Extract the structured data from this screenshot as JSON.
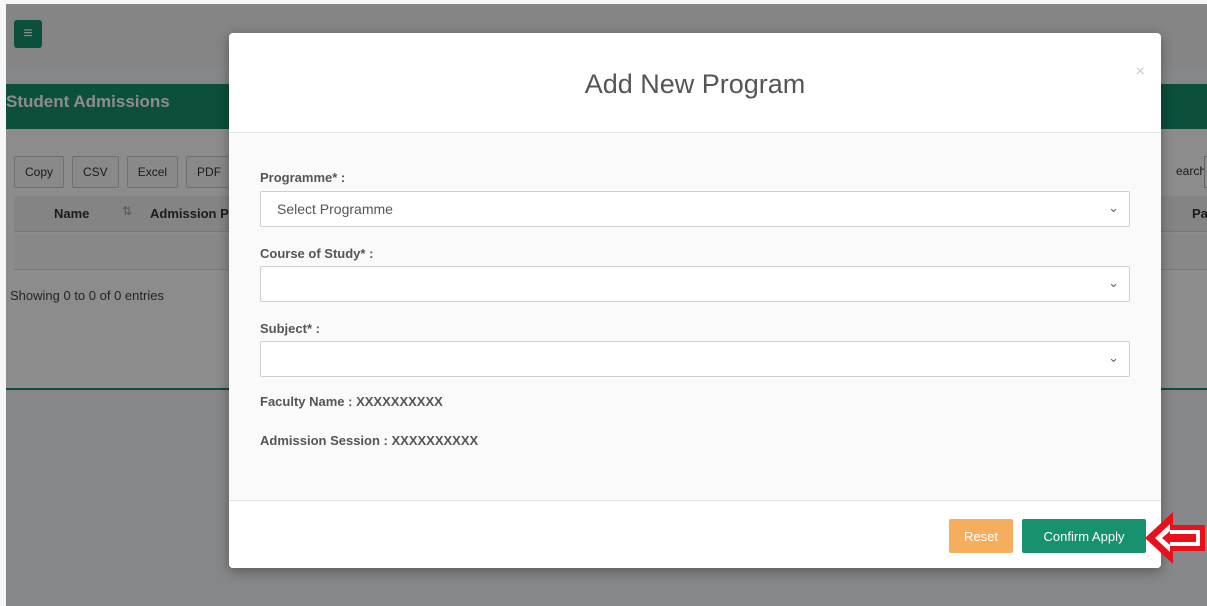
{
  "background": {
    "section_title": "Student Admissions",
    "export_buttons": [
      "Copy",
      "CSV",
      "Excel",
      "PDF"
    ],
    "search_label": "earch:",
    "table": {
      "col_name": "Name",
      "col_admission": "Admission P",
      "col_last": "Pa"
    },
    "showing_text": "Showing 0 to 0 of 0 entries"
  },
  "modal": {
    "title": "Add New Program",
    "close_symbol": "×",
    "fields": {
      "programme_label": "Programme* :",
      "programme_value": "Select Programme",
      "course_label": "Course of Study* :",
      "course_value": "",
      "subject_label": "Subject* :",
      "subject_value": ""
    },
    "faculty_line": "Faculty Name : XXXXXXXXXX",
    "session_line": "Admission Session : XXXXXXXXXX",
    "reset_label": "Reset",
    "confirm_label": "Confirm Apply"
  },
  "icons": {
    "menu": "hamburger-icon",
    "sort": "sort-icon",
    "chevron": "chevron-down-icon",
    "pointer": "red-arrow-icon"
  },
  "colors": {
    "brand_green": "#17916e",
    "reset_orange": "#f5ad5e",
    "arrow_red": "#e8111b"
  }
}
